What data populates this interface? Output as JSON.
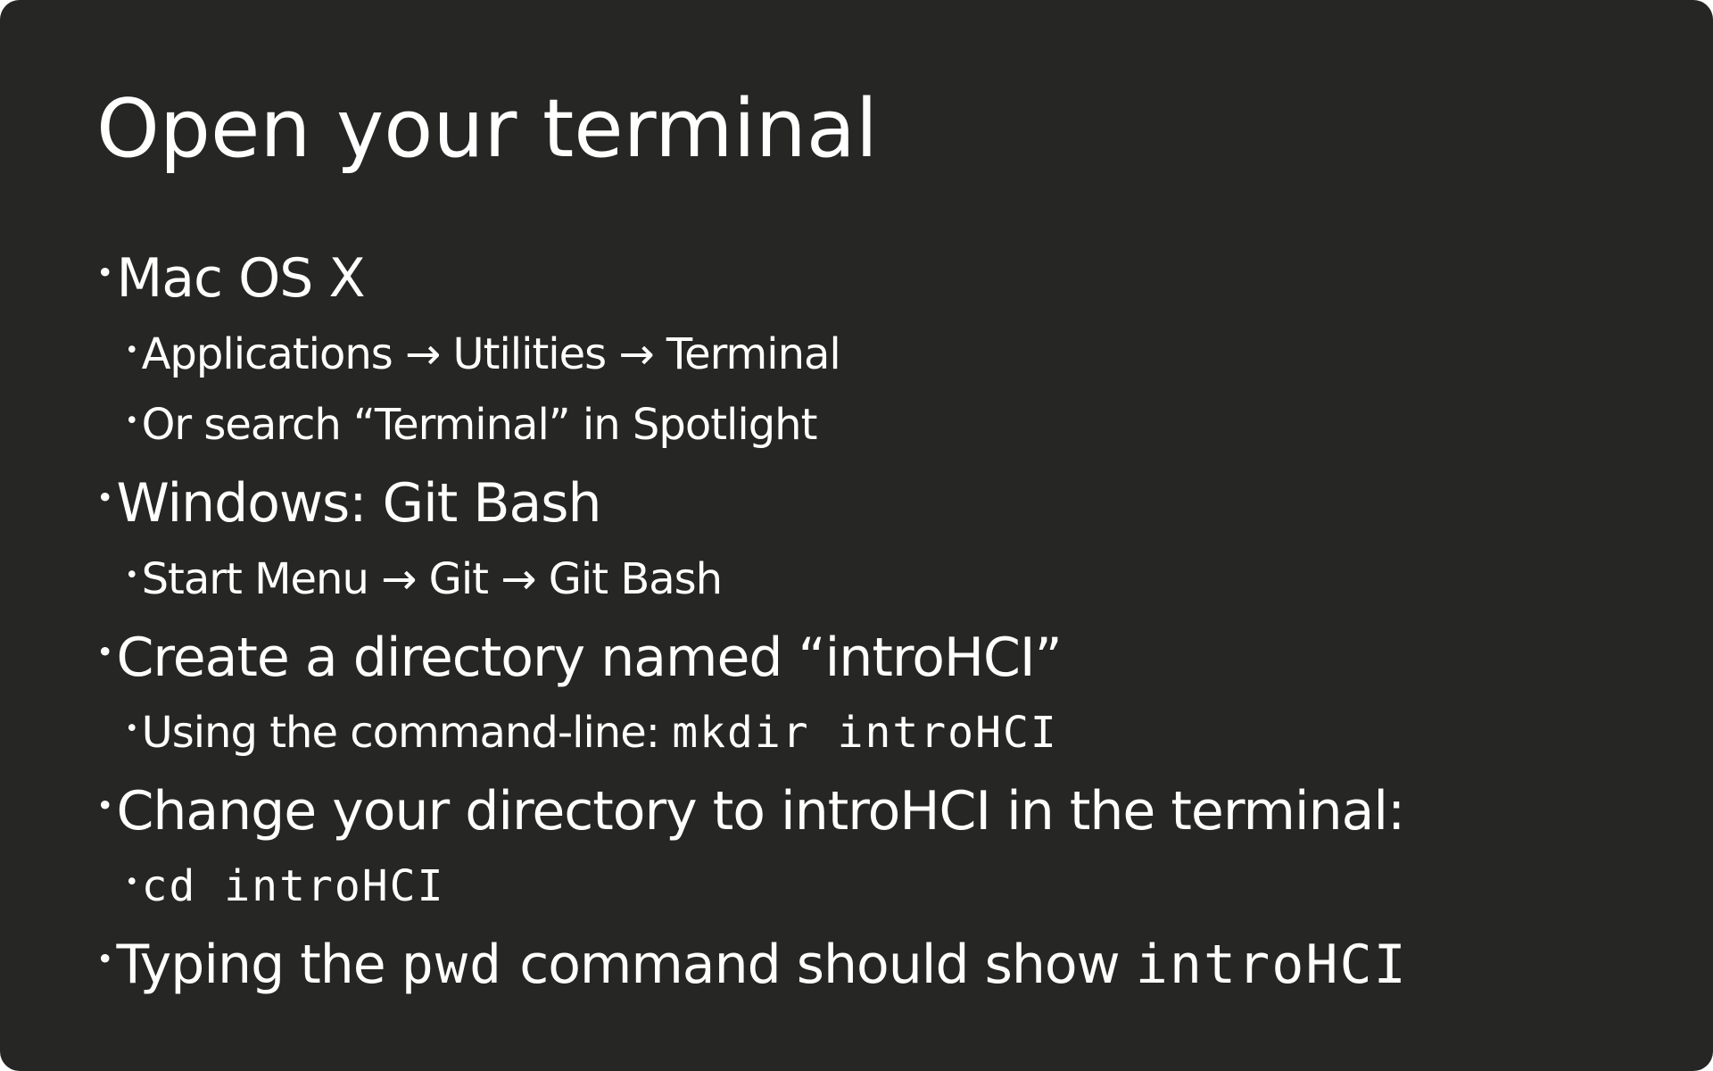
{
  "slide": {
    "title": "Open your terminal",
    "bullet_glyph": "•",
    "items": [
      {
        "text": "Mac OS X"
      },
      {
        "text": "Applications → Utilities → Terminal"
      },
      {
        "text": "Or search “Terminal” in Spotlight"
      },
      {
        "text": "Windows: Git Bash"
      },
      {
        "text": "Start Menu → Git → Git Bash"
      },
      {
        "text": "Create a directory named “introHCI”"
      },
      {
        "prefix": "Using the command-line: ",
        "code": "mkdir introHCI"
      },
      {
        "text": "Change your directory to introHCI in the terminal:"
      },
      {
        "code": "cd introHCI"
      },
      {
        "prefix": "Typing the ",
        "code": "pwd",
        "middle": " command should show ",
        "code2": "introHCI"
      }
    ]
  }
}
